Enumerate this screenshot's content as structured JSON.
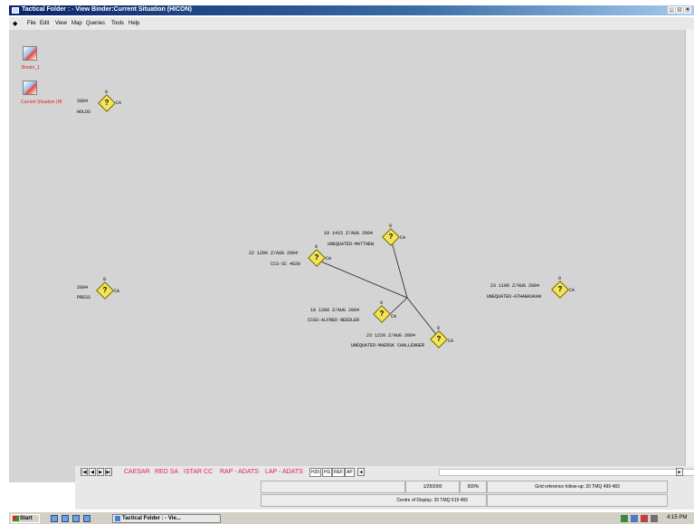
{
  "window": {
    "title": "Tactical Folder : - View Binder:Current Situation (HICON)",
    "controls": [
      "_",
      "□",
      "×"
    ]
  },
  "menu": {
    "back_glyph": "◆",
    "items": [
      "File",
      "Edit",
      "View",
      "Map",
      "Queries",
      "Tools",
      "Help"
    ]
  },
  "binders": [
    {
      "label": "Binder_1",
      "icon": "binder-icon"
    },
    {
      "label": "Current Situation (HI",
      "icon": "current-situation-icon"
    }
  ],
  "map": {
    "unit_symbol": "?",
    "unit_suffix": "CA",
    "unit_tick": "0",
    "units": [
      {
        "id": "u-top-left",
        "dtg": "2004",
        "name": "HOLDS"
      },
      {
        "id": "u-mathew",
        "dtg": "18 1415 Z/AUG 2004",
        "name": "UNEQUATED-MATTHEW"
      },
      {
        "id": "u-ccs",
        "dtg": "22 1200 Z/AUG 2004",
        "name": "CCS-SC 4620"
      },
      {
        "id": "u-left-mid",
        "dtg": "2004",
        "name": "PRESS"
      },
      {
        "id": "u-ahab",
        "dtg": "23 1100 Z/AUG 2004",
        "name": "UNEQUATED-ATHABASKAN"
      },
      {
        "id": "u-alfred",
        "dtg": "18 1300 Z/AUG 2004",
        "name": "CCGS-ALFRED NEEDLER"
      },
      {
        "id": "u-maersk",
        "dtg": "23 1220 Z/AUG 2004",
        "name": "UNEQUATED-MAERSK CHALLENGER"
      }
    ]
  },
  "tabs": {
    "nav": [
      "|◀",
      "◀",
      "▶",
      "▶|"
    ],
    "binder_tabs": [
      "CAESAR",
      "RED SA",
      "ISTAR CC",
      "RAP - ADATS",
      "LAP - ADATS"
    ],
    "small_tabs": [
      "H20",
      "HS",
      "REF",
      "AP"
    ],
    "scroll_left": "◄",
    "scroll_right": "►"
  },
  "status": {
    "scale": "1/250000",
    "zoom": "500%",
    "grid_ref": "Grid reference follow-up: 20 TMQ 499 483",
    "centre": "Centre of Display:  20 TMQ 519 465"
  },
  "taskbar": {
    "start": "Start",
    "task": "Tactical Folder : - Vie...",
    "clock": "4:15 PM"
  },
  "colors": {
    "titlebar": "#0a246a",
    "map_bg": "#d4d4d4",
    "unit_fill": "#f5e35a",
    "binder_label": "#e02020",
    "binder_tab": "#e0205a"
  }
}
